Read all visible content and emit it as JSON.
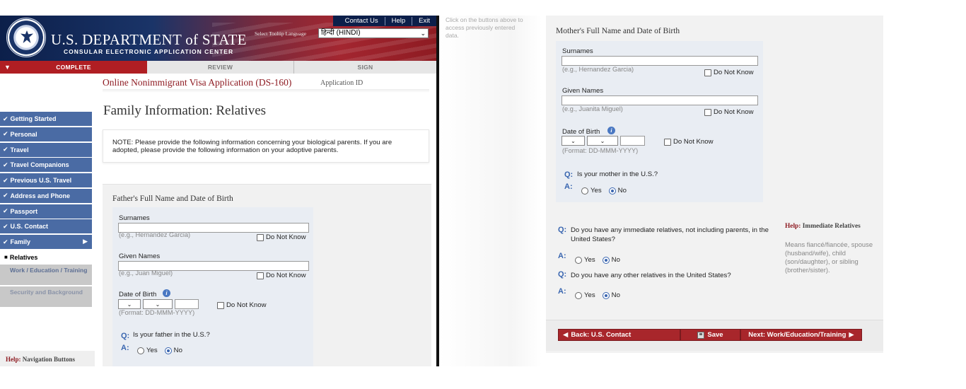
{
  "header": {
    "dept_title": "U.S. DEPARTMENT of STATE",
    "dept_subtitle": "CONSULAR ELECTRONIC APPLICATION CENTER",
    "top_links": [
      "Contact Us",
      "Help",
      "Exit"
    ],
    "language_label": "Select Tooltip Language",
    "language_value": "हिन्दी (HINDI)"
  },
  "progress": {
    "complete": "COMPLETE",
    "review": "REVIEW",
    "sign": "SIGN"
  },
  "app_title": "Online Nonimmigrant Visa Application (DS-160)",
  "application_id_label": "Application ID",
  "sidebar": {
    "items": [
      "Getting Started",
      "Personal",
      "Travel",
      "Travel Companions",
      "Previous U.S. Travel",
      "Address and Phone",
      "Passport",
      "U.S. Contact",
      "Family"
    ],
    "active": "Relatives",
    "pending": [
      "Work / Education / Training",
      "Security and Background"
    ]
  },
  "help_nav": {
    "prefix": "Help:",
    "label": "Navigation Buttons"
  },
  "page_heading": "Family Information: Relatives",
  "note": "NOTE: Please provide the following information concerning your biological parents. If you are adopted, please provide the following information on your adoptive parents.",
  "common": {
    "surnames": "Surnames",
    "given_names": "Given Names",
    "dob": "Date of Birth",
    "dnk": "Do Not Know",
    "dob_format": "(Format: DD-MMM-YYYY)",
    "q": "Q:",
    "a": "A:",
    "yes": "Yes",
    "no": "No"
  },
  "father": {
    "title": "Father's Full Name and Date of Birth",
    "surname_hint": "(e.g., Hernandez Garcia)",
    "given_hint": "(e.g., Juan Miguel)",
    "question": "Is your father in the U.S.?",
    "answer": "No"
  },
  "mother": {
    "title": "Mother's Full Name and Date of Birth",
    "surname_hint": "(e.g., Hernandez Garcia)",
    "given_hint": "(e.g., Juanita Miguel)",
    "question": "Is your mother in the U.S.?",
    "answer": "No"
  },
  "relatives": {
    "q_immediate": "Do you have any immediate relatives, not including parents, in the United States?",
    "q_other": "Do you have any other relatives in the United States?"
  },
  "help_relatives": {
    "prefix": "Help:",
    "title": "Immediate Relatives",
    "body": "Means fiancé/fiancée, spouse (husband/wife), child (son/daughter), or sibling (brother/sister)."
  },
  "middle_note": "Click on the buttons above to access previously entered data.",
  "nav_buttons": {
    "back": "Back: U.S. Contact",
    "save": "Save",
    "next": "Next: Work/Education/Training"
  },
  "colors": {
    "primary_blue": "#4a6ba4",
    "accent_red": "#a8262b",
    "question_blue": "#3a66b0"
  }
}
